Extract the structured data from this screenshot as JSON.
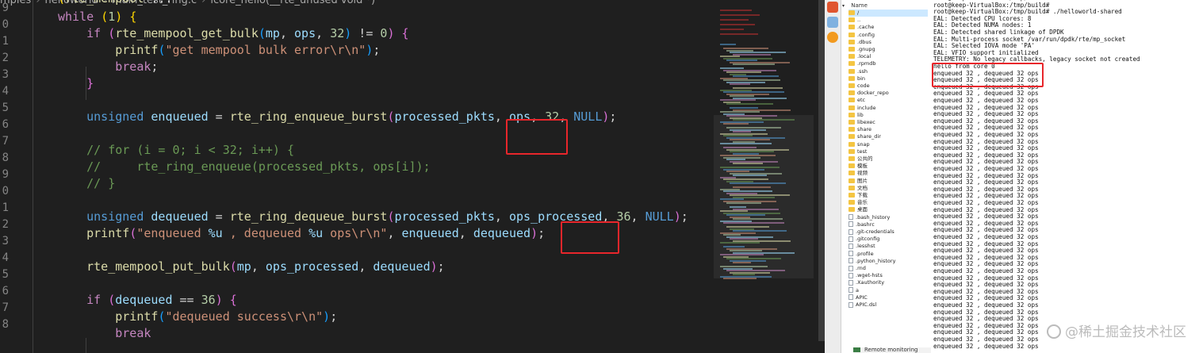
{
  "editor": {
    "breadcrumb": [
      "mples",
      "helloworld",
      "main_test_ring.c",
      "lcore_hello(__rte_unused void *)"
    ],
    "line_numbers": [
      "9",
      "0",
      "1",
      "2",
      "3",
      "4",
      "5",
      "6",
      "7",
      "8",
      "9",
      "0",
      "1",
      "2",
      "3",
      "4",
      "5",
      "6",
      "7",
      "8"
    ],
    "code_lines": [
      [
        {
          "t": "(",
          "c": "b1"
        },
        {
          "t": "rte_mempool",
          "c": "fn"
        },
        {
          "t": " ",
          "c": "pn"
        },
        {
          "t": "...",
          "c": "pn"
        },
        {
          "t": "  ",
          "c": "pn"
        }
      ],
      [
        {
          "t": "while ",
          "c": "ctl"
        },
        {
          "t": "(",
          "c": "b1"
        },
        {
          "t": "1",
          "c": "num"
        },
        {
          "t": ") ",
          "c": "b1"
        },
        {
          "t": "{",
          "c": "b1"
        }
      ],
      [
        {
          "t": "    if ",
          "c": "ctl"
        },
        {
          "t": "(",
          "c": "b2"
        },
        {
          "t": "rte_mempool_get_bulk",
          "c": "fn"
        },
        {
          "t": "(",
          "c": "b3"
        },
        {
          "t": "mp",
          "c": "var"
        },
        {
          "t": ", ",
          "c": "pn"
        },
        {
          "t": "ops",
          "c": "var"
        },
        {
          "t": ", ",
          "c": "pn"
        },
        {
          "t": "32",
          "c": "num"
        },
        {
          "t": ")",
          "c": "b3"
        },
        {
          "t": " != ",
          "c": "pn"
        },
        {
          "t": "0",
          "c": "num"
        },
        {
          "t": ") ",
          "c": "b2"
        },
        {
          "t": "{",
          "c": "b2"
        }
      ],
      [
        {
          "t": "        printf",
          "c": "fn"
        },
        {
          "t": "(",
          "c": "b3"
        },
        {
          "t": "\"get mempool bulk error\\r\\n\"",
          "c": "str"
        },
        {
          "t": ")",
          "c": "b3"
        },
        {
          "t": ";",
          "c": "pn"
        }
      ],
      [
        {
          "t": "        break",
          "c": "ctl"
        },
        {
          "t": ";",
          "c": "pn"
        }
      ],
      [
        {
          "t": "    }",
          "c": "b2"
        }
      ],
      [],
      [
        {
          "t": "    unsigned ",
          "c": "kw"
        },
        {
          "t": "enqueued",
          "c": "var"
        },
        {
          "t": " = ",
          "c": "pn"
        },
        {
          "t": "rte_ring_enqueue_burst",
          "c": "fn"
        },
        {
          "t": "(",
          "c": "b2"
        },
        {
          "t": "processed_pkts",
          "c": "var"
        },
        {
          "t": ", ",
          "c": "pn"
        },
        {
          "t": "ops",
          "c": "var"
        },
        {
          "t": ", ",
          "c": "pn"
        },
        {
          "t": "32",
          "c": "num"
        },
        {
          "t": ", ",
          "c": "pn"
        },
        {
          "t": "NULL",
          "c": "kw"
        },
        {
          "t": ")",
          "c": "b2"
        },
        {
          "t": ";",
          "c": "pn"
        }
      ],
      [],
      [
        {
          "t": "    // for (i = 0; i < 32; i++) {",
          "c": "cm"
        }
      ],
      [
        {
          "t": "    //     rte_ring_enqueue(processed_pkts, ops[i]);",
          "c": "cm"
        }
      ],
      [
        {
          "t": "    // }",
          "c": "cm"
        }
      ],
      [],
      [
        {
          "t": "    unsigned ",
          "c": "kw"
        },
        {
          "t": "dequeued",
          "c": "var"
        },
        {
          "t": " = ",
          "c": "pn"
        },
        {
          "t": "rte_ring_dequeue_burst",
          "c": "fn"
        },
        {
          "t": "(",
          "c": "b2"
        },
        {
          "t": "processed_pkts",
          "c": "var"
        },
        {
          "t": ", ",
          "c": "pn"
        },
        {
          "t": "ops_processed",
          "c": "var"
        },
        {
          "t": ", ",
          "c": "pn"
        },
        {
          "t": "36",
          "c": "num"
        },
        {
          "t": ", ",
          "c": "pn"
        },
        {
          "t": "NULL",
          "c": "kw"
        },
        {
          "t": ")",
          "c": "b2"
        },
        {
          "t": ";",
          "c": "pn"
        }
      ],
      [
        {
          "t": "    printf",
          "c": "fn"
        },
        {
          "t": "(",
          "c": "b2"
        },
        {
          "t": "\"enqueued ",
          "c": "str"
        },
        {
          "t": "%u",
          "c": "var"
        },
        {
          "t": " , dequeued ",
          "c": "str"
        },
        {
          "t": "%u",
          "c": "var"
        },
        {
          "t": " ops\\r\\n\"",
          "c": "str"
        },
        {
          "t": ", ",
          "c": "pn"
        },
        {
          "t": "enqueued",
          "c": "var"
        },
        {
          "t": ", ",
          "c": "pn"
        },
        {
          "t": "dequeued",
          "c": "var"
        },
        {
          "t": ")",
          "c": "b2"
        },
        {
          "t": ";",
          "c": "pn"
        }
      ],
      [],
      [
        {
          "t": "    rte_mempool_put_bulk",
          "c": "fn"
        },
        {
          "t": "(",
          "c": "b2"
        },
        {
          "t": "mp",
          "c": "var"
        },
        {
          "t": ", ",
          "c": "pn"
        },
        {
          "t": "ops_processed",
          "c": "var"
        },
        {
          "t": ", ",
          "c": "pn"
        },
        {
          "t": "dequeued",
          "c": "var"
        },
        {
          "t": ")",
          "c": "b2"
        },
        {
          "t": ";",
          "c": "pn"
        }
      ],
      [],
      [
        {
          "t": "    if ",
          "c": "ctl"
        },
        {
          "t": "(",
          "c": "b2"
        },
        {
          "t": "dequeued",
          "c": "var"
        },
        {
          "t": " == ",
          "c": "pn"
        },
        {
          "t": "36",
          "c": "num"
        },
        {
          "t": ") ",
          "c": "b2"
        },
        {
          "t": "{",
          "c": "b2"
        }
      ],
      [
        {
          "t": "        printf",
          "c": "fn"
        },
        {
          "t": "(",
          "c": "b3"
        },
        {
          "t": "\"dequeued success\\r\\n\"",
          "c": "str"
        },
        {
          "t": ")",
          "c": "b3"
        },
        {
          "t": ";",
          "c": "pn"
        }
      ],
      [
        {
          "t": "        break",
          "c": "ctl"
        }
      ]
    ]
  },
  "file_panel": {
    "header": "Name",
    "items": [
      {
        "name": "/",
        "type": "folder",
        "sel": true
      },
      {
        "name": "..",
        "type": "folder"
      },
      {
        "name": ".cache",
        "type": "folder"
      },
      {
        "name": ".config",
        "type": "folder"
      },
      {
        "name": ".dbus",
        "type": "folder"
      },
      {
        "name": ".gnupg",
        "type": "folder"
      },
      {
        "name": ".local",
        "type": "folder"
      },
      {
        "name": ".rpmdb",
        "type": "folder"
      },
      {
        "name": ".ssh",
        "type": "folder"
      },
      {
        "name": "bin",
        "type": "folder"
      },
      {
        "name": "code",
        "type": "folder"
      },
      {
        "name": "docker_repo",
        "type": "folder"
      },
      {
        "name": "etc",
        "type": "folder"
      },
      {
        "name": "include",
        "type": "folder"
      },
      {
        "name": "lib",
        "type": "folder"
      },
      {
        "name": "libexec",
        "type": "folder"
      },
      {
        "name": "share",
        "type": "folder"
      },
      {
        "name": "share_dir",
        "type": "folder"
      },
      {
        "name": "snap",
        "type": "folder"
      },
      {
        "name": "test",
        "type": "folder"
      },
      {
        "name": "公共的",
        "type": "folder"
      },
      {
        "name": "模板",
        "type": "folder"
      },
      {
        "name": "视频",
        "type": "folder"
      },
      {
        "name": "图片",
        "type": "folder"
      },
      {
        "name": "文档",
        "type": "folder"
      },
      {
        "name": "下载",
        "type": "folder"
      },
      {
        "name": "音乐",
        "type": "folder"
      },
      {
        "name": "桌面",
        "type": "folder"
      },
      {
        "name": ".bash_history",
        "type": "file"
      },
      {
        "name": ".bashrc",
        "type": "file"
      },
      {
        "name": ".git-credentials",
        "type": "file"
      },
      {
        "name": ".gitconfig",
        "type": "file"
      },
      {
        "name": ".lesshst",
        "type": "file"
      },
      {
        "name": ".profile",
        "type": "file"
      },
      {
        "name": ".python_history",
        "type": "file"
      },
      {
        "name": ".rnd",
        "type": "file"
      },
      {
        "name": ".wget-hsts",
        "type": "file"
      },
      {
        "name": ".Xauthority",
        "type": "file"
      },
      {
        "name": "a",
        "type": "file"
      },
      {
        "name": "APIC",
        "type": "file"
      },
      {
        "name": "APIC.dsl",
        "type": "file"
      }
    ],
    "remote_monitoring": "Remote monitoring"
  },
  "terminal": {
    "header_lines": [
      "root@keep-VirtualBox:/tmp/build#",
      "root@keep-VirtualBox:/tmp/build#",
      "root@keep-VirtualBox:/tmp/build# ./helloworld-shared",
      "EAL: Detected CPU lcores: 8",
      "EAL: Detected NUMA nodes: 1",
      "EAL: Detected shared linkage of DPDK",
      "EAL: Multi-process socket /var/run/dpdk/rte/mp_socket",
      "EAL: Selected IOVA mode 'PA'",
      "EAL: VFIO support initialized",
      "TELEMETRY: No legacy callbacks, legacy socket not created",
      "hello from core 0"
    ],
    "repeat_line": "enqueued 32 , dequeued 32 ops",
    "repeat_count": 41
  },
  "watermark": "@稀土掘金技术社区",
  "colors": {
    "highlight_box": "#e8262b",
    "editor_bg": "#1f1f1f"
  }
}
